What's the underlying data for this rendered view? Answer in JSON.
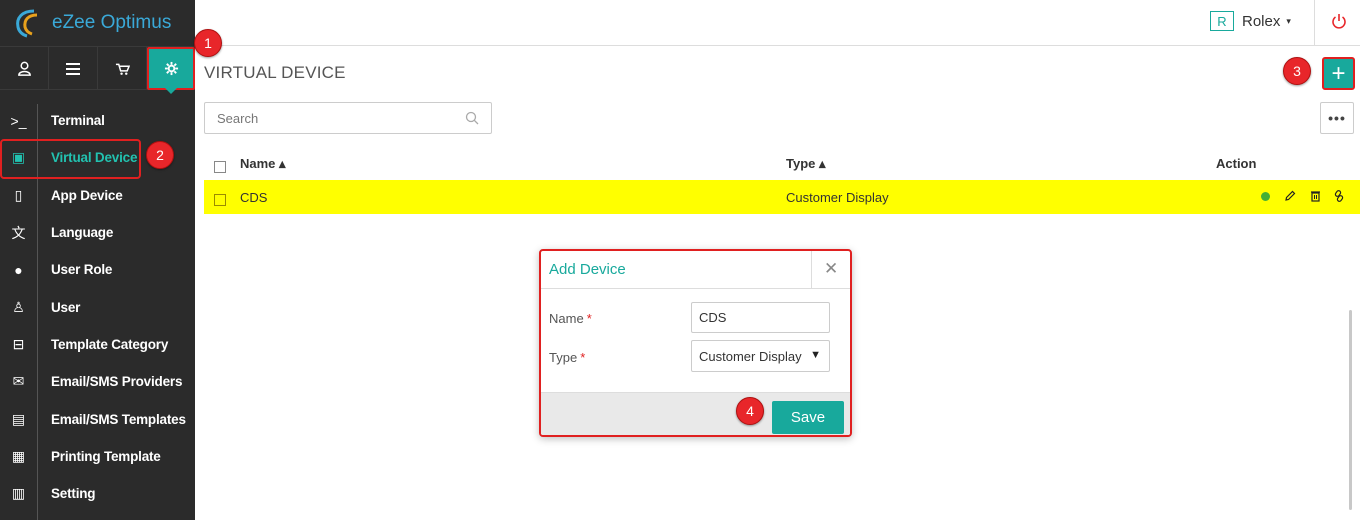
{
  "app": {
    "name": "eZee Optimus"
  },
  "topbar": {
    "user_initial": "R",
    "user_name": "Rolex",
    "caret": "▾",
    "power_icon": "power-icon"
  },
  "icon_tabs": [
    {
      "name": "user-icon",
      "glyph": "♙"
    },
    {
      "name": "menu-icon",
      "glyph": "☰"
    },
    {
      "name": "cart-icon",
      "glyph": "🛒"
    },
    {
      "name": "gear-icon",
      "glyph": "⚙"
    }
  ],
  "sidebar": {
    "items": [
      {
        "label": "Terminal",
        "icon": "terminal-icon",
        "glyph": ">_"
      },
      {
        "label": "Virtual Device",
        "icon": "tablet-icon",
        "glyph": "▣"
      },
      {
        "label": "App Device",
        "icon": "phone-icon",
        "glyph": "▯"
      },
      {
        "label": "Language",
        "icon": "language-icon",
        "glyph": "文"
      },
      {
        "label": "User Role",
        "icon": "user-role-icon",
        "glyph": "●"
      },
      {
        "label": "User",
        "icon": "user-icon",
        "glyph": "♙"
      },
      {
        "label": "Template Category",
        "icon": "inbox-icon",
        "glyph": "⊟"
      },
      {
        "label": "Email/SMS Providers",
        "icon": "envelope-icon",
        "glyph": "✉"
      },
      {
        "label": "Email/SMS Templates",
        "icon": "template-icon",
        "glyph": "▤"
      },
      {
        "label": "Printing Template",
        "icon": "receipt-icon",
        "glyph": "▦"
      },
      {
        "label": "Setting",
        "icon": "settings-sliders-icon",
        "glyph": "▥"
      }
    ]
  },
  "main": {
    "title": "VIRTUAL DEVICE",
    "add_button": "+",
    "more_button": "•••",
    "search": {
      "placeholder": "Search"
    },
    "table": {
      "headers": {
        "name": "Name ▴",
        "type": "Type ▴",
        "action": "Action"
      },
      "rows": [
        {
          "name": "CDS",
          "type": "Customer Display"
        }
      ]
    }
  },
  "modal": {
    "title": "Add Device",
    "close": "✕",
    "name_label": "Name",
    "type_label": "Type",
    "required_mark": "*",
    "name_value": "CDS",
    "type_value": "Customer Display",
    "select_caret": "▼",
    "save_label": "Save"
  },
  "callouts": [
    "1",
    "2",
    "3",
    "4"
  ],
  "colors": {
    "accent": "#18a99c",
    "highlight": "#ffff00",
    "callout": "#e8262a",
    "sidebar": "#2b2b2b"
  }
}
